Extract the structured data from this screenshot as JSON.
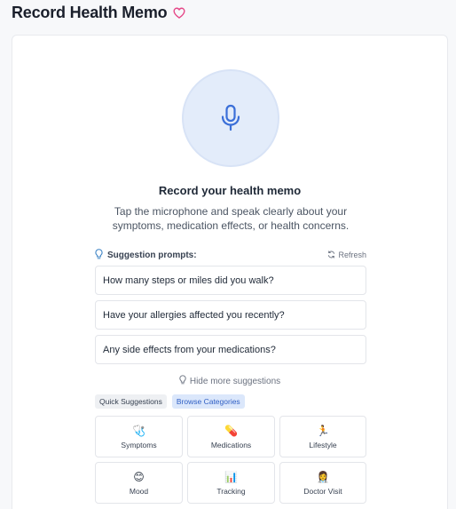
{
  "header": {
    "title": "Record Health Memo",
    "heart_icon": "heart-outline-icon",
    "heart_color": "#e54888"
  },
  "recorder": {
    "mic_icon": "microphone-icon",
    "mic_color": "#3b6fd8",
    "title": "Record your health memo",
    "description": "Tap the microphone and speak clearly about your symptoms, medication effects, or health concerns."
  },
  "suggestions": {
    "label": "Suggestion prompts:",
    "refresh_label": "Refresh",
    "prompts": [
      "How many steps or miles did you walk?",
      "Have your allergies affected you recently?",
      "Any side effects from your medications?"
    ],
    "hide_more_label": "Hide more suggestions"
  },
  "tabs": {
    "quick_label": "Quick Suggestions",
    "browse_label": "Browse Categories",
    "active": "Browse Categories"
  },
  "categories": [
    {
      "label": "Symptoms",
      "icon": "🩺"
    },
    {
      "label": "Medications",
      "icon": "💊"
    },
    {
      "label": "Lifestyle",
      "icon": "🏃"
    },
    {
      "label": "Mood",
      "icon": "😊"
    },
    {
      "label": "Tracking",
      "icon": "📊"
    },
    {
      "label": "Doctor Visit",
      "icon": "👩‍⚕️"
    }
  ]
}
